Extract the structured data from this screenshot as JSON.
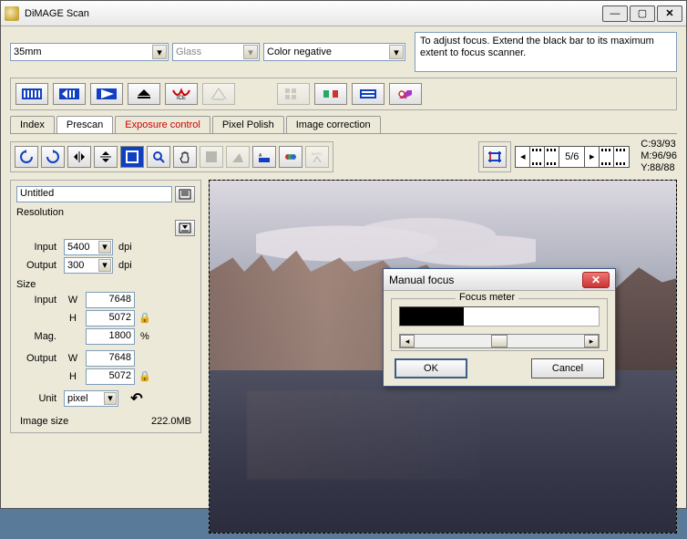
{
  "titlebar": {
    "title": "DiMAGE Scan"
  },
  "dropdowns": {
    "film_format": "35mm",
    "holder": "Glass",
    "film_type": "Color negative"
  },
  "info_text": "To adjust focus. Extend the black bar to its maximum extent to focus scanner.",
  "tabs": {
    "index": "Index",
    "prescan": "Prescan",
    "exposure": "Exposure control",
    "pixel_polish": "Pixel Polish",
    "image_correction": "Image correction"
  },
  "frame": {
    "current": "5/6"
  },
  "readouts": {
    "c": "C:93/93",
    "m": "M:96/96",
    "y": "Y:88/88"
  },
  "left": {
    "usage": "Untitled",
    "resolution_label": "Resolution",
    "input_label": "Input",
    "output_label": "Output",
    "input_res": "5400",
    "output_res": "300",
    "dpi": "dpi",
    "size_label": "Size",
    "w": "W",
    "h": "H",
    "mag": "Mag.",
    "input_w": "7648",
    "input_h": "5072",
    "mag_val": "1800",
    "pct": "%",
    "output_w": "7648",
    "output_h": "5072",
    "unit_label": "Unit",
    "unit_val": "pixel",
    "image_size_label": "Image size",
    "image_size_val": "222.0MB"
  },
  "dialog": {
    "title": "Manual focus",
    "legend": "Focus meter",
    "ok": "OK",
    "cancel": "Cancel"
  }
}
